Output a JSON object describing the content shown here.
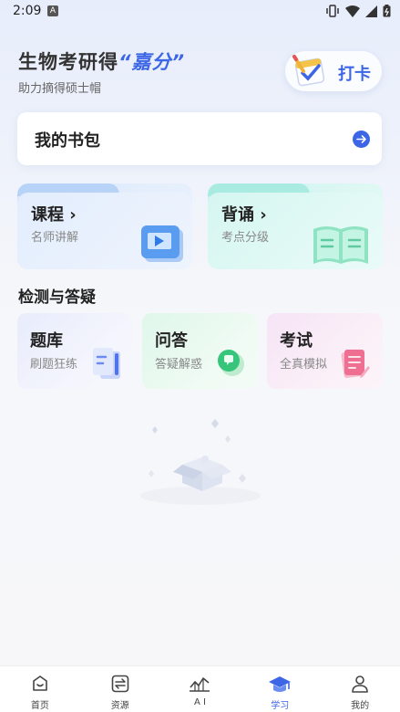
{
  "status": {
    "time": "2:09",
    "notif_letter": "A"
  },
  "header": {
    "title_prefix": "生物考研得",
    "title_accent": "“嘉分”",
    "subtitle": "助力摘得硕士帽",
    "checkin_label": "打卡"
  },
  "bag": {
    "label": "我的书包"
  },
  "features": [
    {
      "title": "课程",
      "subtitle": "名师讲解"
    },
    {
      "title": "背诵",
      "subtitle": "考点分级"
    }
  ],
  "section": {
    "title": "检测与答疑"
  },
  "tools": [
    {
      "title": "题库",
      "subtitle": "刷题狂练"
    },
    {
      "title": "问答",
      "subtitle": "答疑解惑"
    },
    {
      "title": "考试",
      "subtitle": "全真模拟"
    }
  ],
  "nav": [
    {
      "label": "首页",
      "icon": "home-icon"
    },
    {
      "label": "资源",
      "icon": "exchange-icon"
    },
    {
      "label": "A I",
      "icon": "ai-chart-icon"
    },
    {
      "label": "学习",
      "icon": "graduation-cap-icon",
      "active": true
    },
    {
      "label": "我的",
      "icon": "user-icon"
    }
  ],
  "colors": {
    "accent": "#3c66e6",
    "course": "#d4e5fb",
    "recite": "#c7f1ed"
  }
}
